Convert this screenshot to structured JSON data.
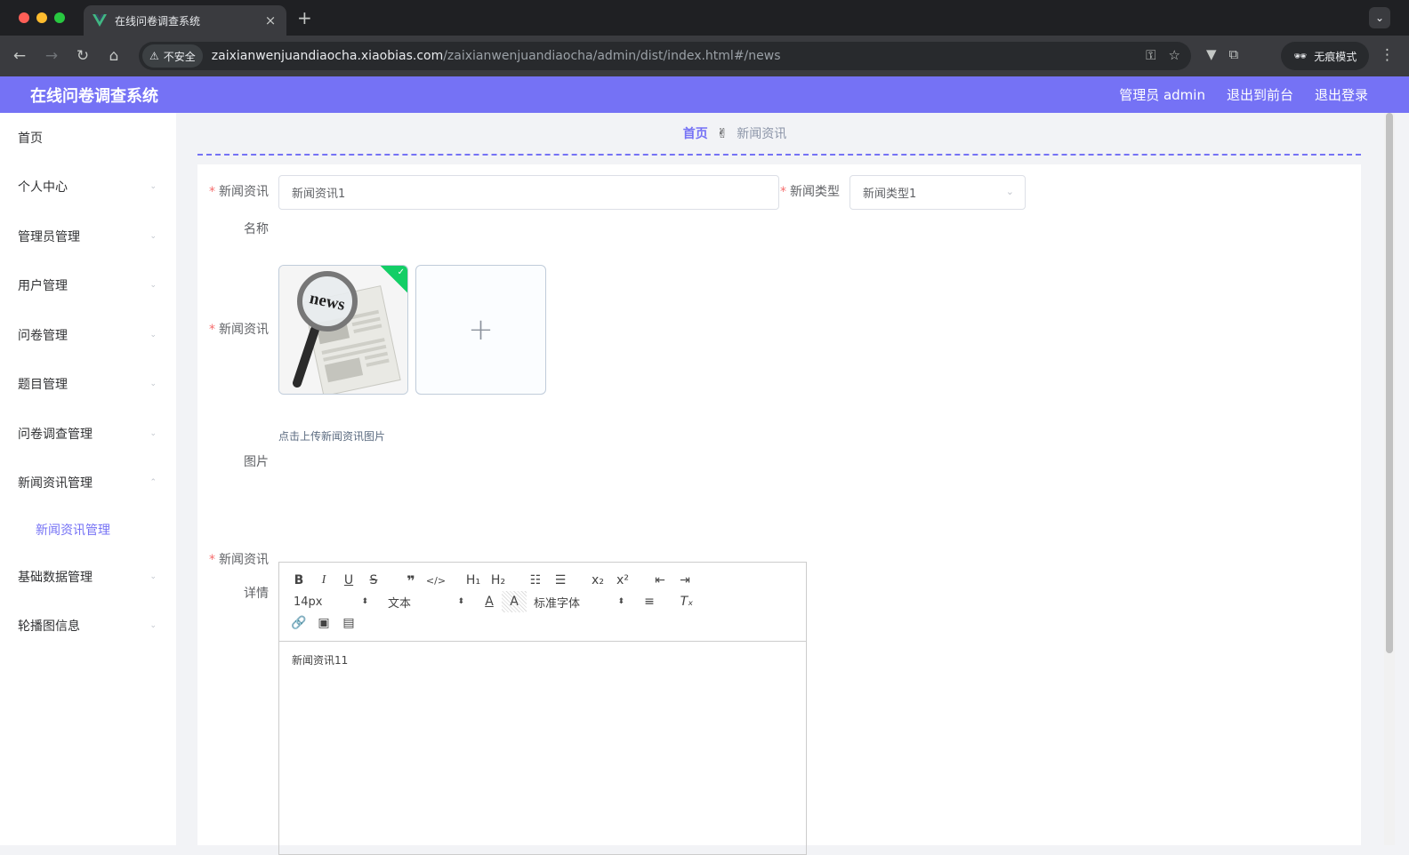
{
  "browser": {
    "tab_title": "在线问卷调查系统",
    "security_label": "不安全",
    "url_host": "zaixianwenjuandiaocha.xiaobias.com",
    "url_path": "/zaixianwenjuandiaocha/admin/dist/index.html#/news",
    "incognito_label": "无痕模式"
  },
  "header": {
    "title": "在线问卷调查系统",
    "user": "管理员 admin",
    "to_front": "退出到前台",
    "logout": "退出登录"
  },
  "sidebar": {
    "items": [
      {
        "label": "首页"
      },
      {
        "label": "个人中心"
      },
      {
        "label": "管理员管理"
      },
      {
        "label": "用户管理"
      },
      {
        "label": "问卷管理"
      },
      {
        "label": "题目管理"
      },
      {
        "label": "问卷调查管理"
      },
      {
        "label": "新闻资讯管理"
      },
      {
        "label": "基础数据管理"
      },
      {
        "label": "轮播图信息"
      }
    ],
    "active_sub": "新闻资讯管理"
  },
  "breadcrumb": {
    "home": "首页",
    "separator": "✌",
    "current": "新闻资讯"
  },
  "form": {
    "name_label_1": "新闻资讯",
    "name_label_2": "名称",
    "name_value": "新闻资讯1",
    "type_label": "新闻类型",
    "type_value": "新闻类型1",
    "image_label_1": "新闻资讯",
    "image_label_2": "图片",
    "upload_tip": "点击上传新闻资讯图片",
    "upload_plus": "+",
    "thumb_text": "news",
    "detail_label_1": "新闻资讯",
    "detail_label_2": "详情",
    "editor": {
      "font_size": "14px",
      "header_select": "文本",
      "font_family": "标准字体",
      "content": "新闻资讯11"
    }
  },
  "colors": {
    "accent": "#7572f5",
    "required": "#f56c6c",
    "success": "#13ce66"
  }
}
